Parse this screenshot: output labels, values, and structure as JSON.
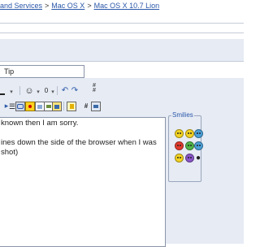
{
  "breadcrumb": {
    "items": [
      "and Services",
      "Mac OS X",
      "Mac OS X 10.7 Lion"
    ],
    "separator": ">"
  },
  "title_field": {
    "value": "Tip"
  },
  "toolbar": {
    "buttons": [
      "font-color",
      "emoticon",
      "attachment",
      "undo",
      "redo",
      "more-options",
      "bullet-list",
      "insert-link",
      "insert-email",
      "insert-image",
      "quote",
      "code",
      "wrap-html",
      "wrap-php"
    ],
    "glyphs": {
      "emoticon": "☺",
      "attachment": "0",
      "undo": "↶",
      "redo": "↷",
      "hash": "#"
    }
  },
  "message": {
    "line1": "known then I am sorry.",
    "line2": "ines down the side of  the browser when I was",
    "line3": "shot)"
  },
  "smilies": {
    "legend": "Smilies",
    "items": [
      "smile",
      "sleepy",
      "confused",
      "angry",
      "laughing",
      "cool",
      "grin",
      "purple-face",
      "apple"
    ],
    "colors": {
      "yellow": "#f3d321",
      "red": "#e23b2e",
      "blue": "#4aa0d8",
      "green": "#4fb64a",
      "purple": "#8a56c9"
    }
  },
  "colors": {
    "link": "#2a57a8",
    "panel": "#e6ebf4",
    "border": "#8a95a8"
  }
}
